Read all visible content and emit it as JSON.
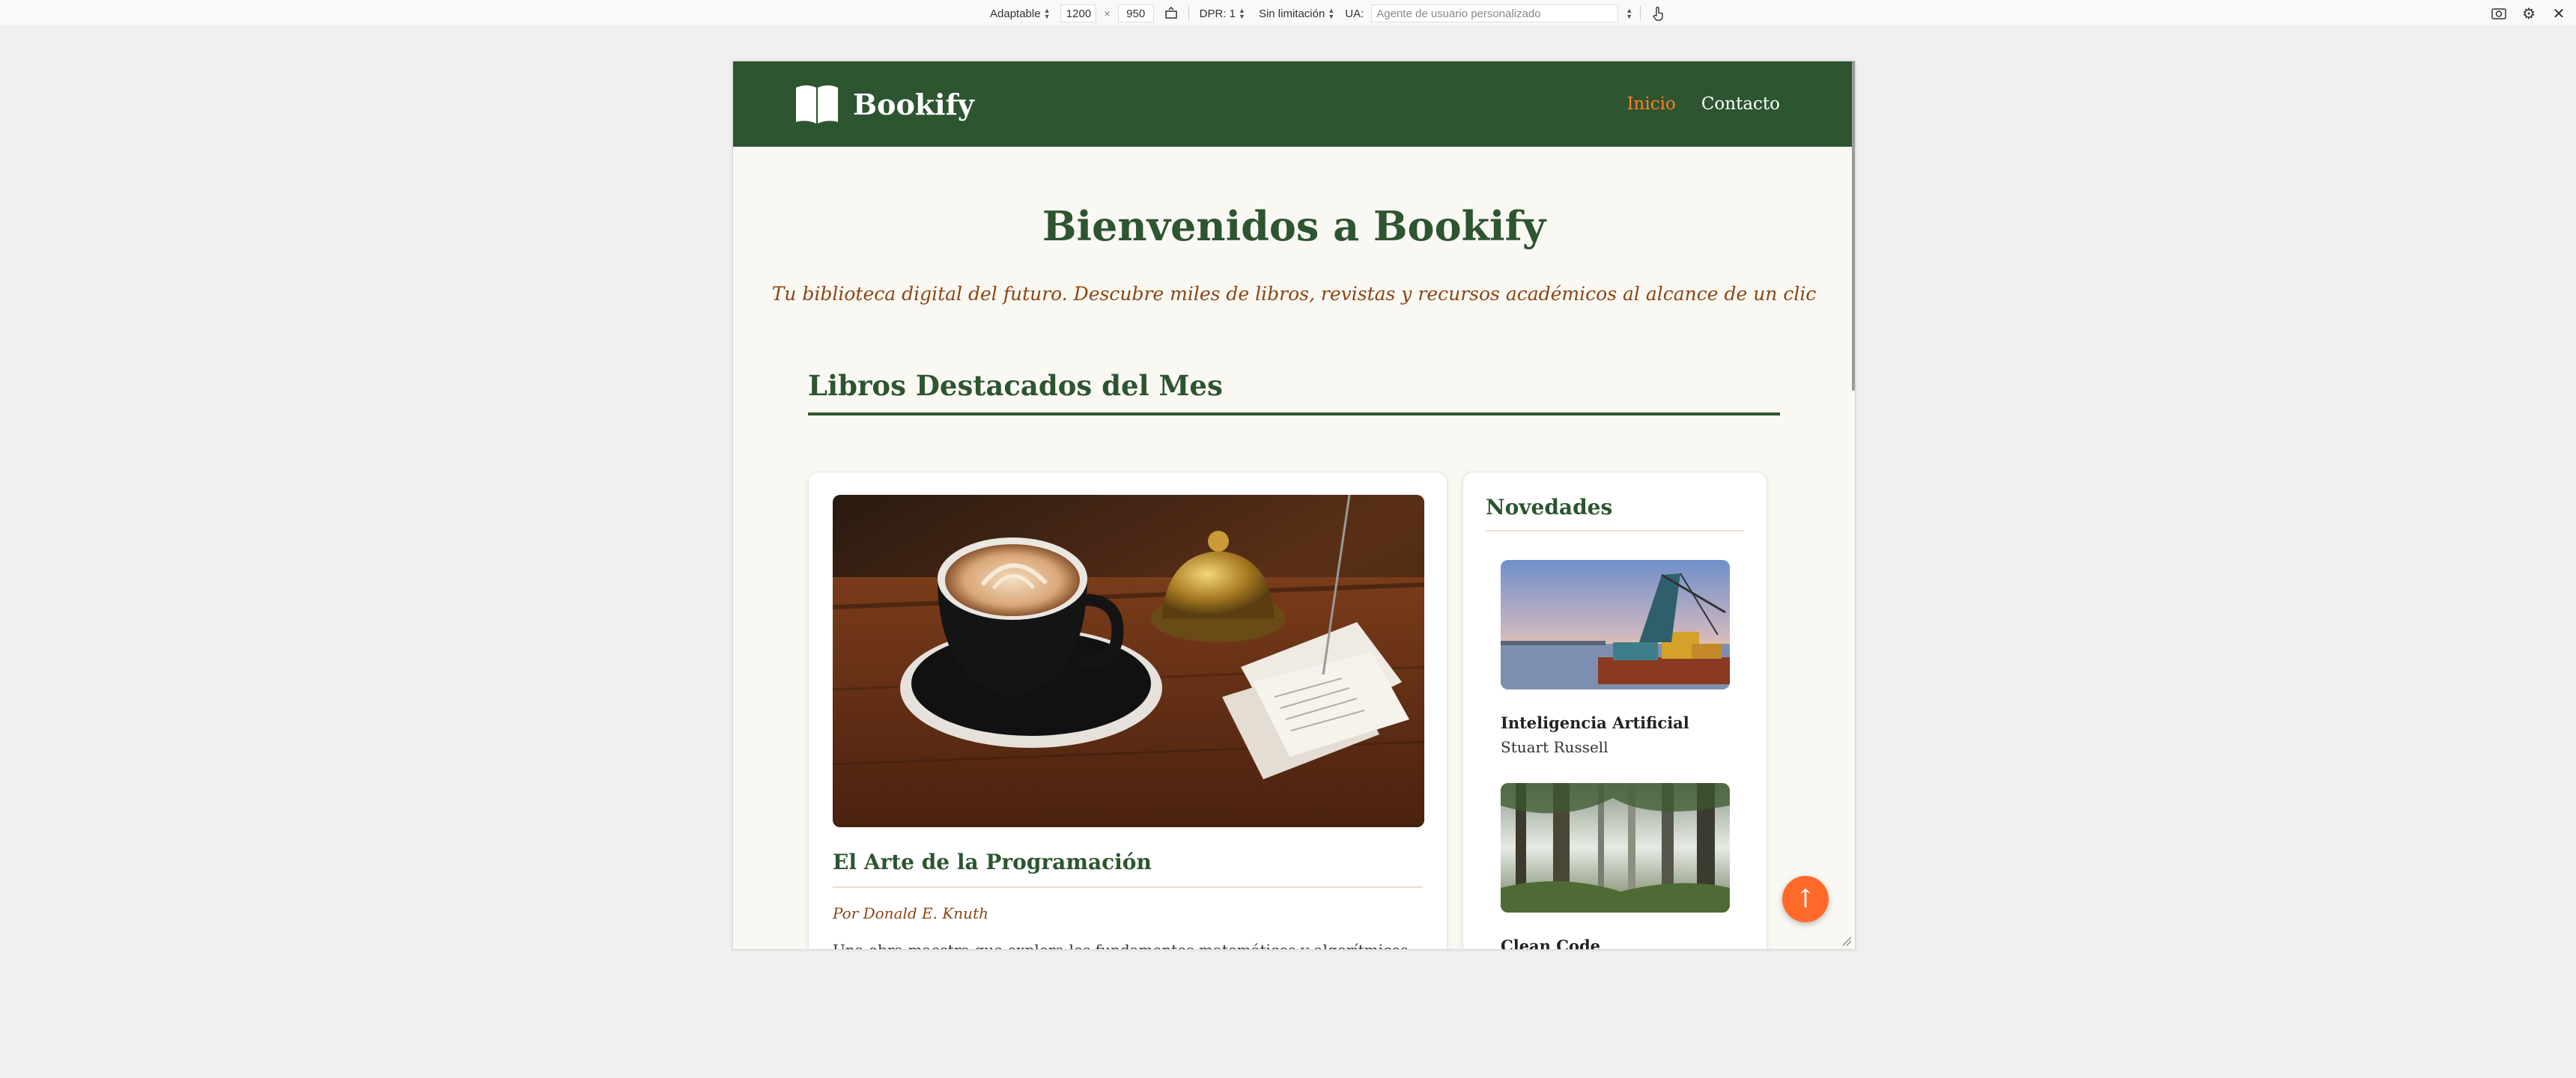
{
  "devtools": {
    "device": "Adaptable",
    "width": "1200",
    "height": "950",
    "times": "×",
    "dpr": "DPR: 1",
    "throttle": "Sin limitación",
    "ua_label": "UA:",
    "ua_placeholder": "Agente de usuario personalizado"
  },
  "site": {
    "brand": "Bookify",
    "nav": [
      {
        "label": "Inicio",
        "active": true
      },
      {
        "label": "Contacto",
        "active": false
      }
    ],
    "hero_title": "Bienvenidos a Bookify",
    "hero_subtitle": "Tu biblioteca digital del futuro. Descubre miles de libros, revistas y recursos académicos al alcance de un clic",
    "section_title": "Libros Destacados del Mes",
    "featured": {
      "title": "El Arte de la Programación",
      "author": "Por Donald E. Knuth",
      "description": "Una obra maestra que explora los fundamentos matemáticos y algorítmicos de la"
    },
    "sidebar": {
      "title": "Novedades",
      "items": [
        {
          "title": "Inteligencia Artificial",
          "author": "Stuart Russell"
        },
        {
          "title": "Clean Code",
          "author": ""
        }
      ]
    },
    "back_to_top": "↑"
  },
  "colors": {
    "header_green": "#2c5530",
    "accent_orange": "#ff7f2a",
    "subtitle_brown": "#8b4513",
    "page_bg": "#faf8f3"
  }
}
